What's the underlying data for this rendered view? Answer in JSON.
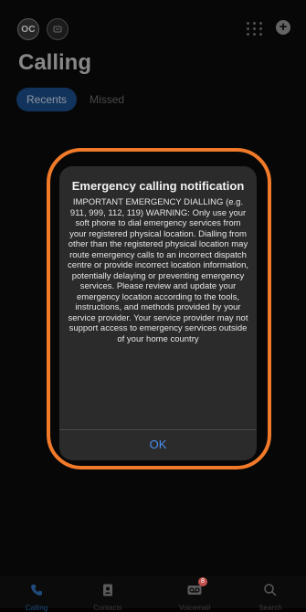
{
  "header": {
    "avatar_initials": "OC",
    "page_title": "Calling"
  },
  "tabs": [
    {
      "label": "Recents",
      "selected": true
    },
    {
      "label": "Missed",
      "selected": false
    }
  ],
  "dialog": {
    "title": "Emergency calling notification",
    "body": "IMPORTANT EMERGENCY DIALLING (e.g. 911, 999, 112, 119) WARNING: Only use your soft phone to dial emergency services from your registered physical location. Dialling from other than the registered physical location may route emergency calls to an incorrect dispatch centre or provide incorrect location information, potentially delaying or preventing emergency services. Please review and update your emergency location according to the tools, instructions, and methods provided by your service provider. Your service provider may not support access to emergency services outside of your home country",
    "ok_label": "OK"
  },
  "bottom_nav": [
    {
      "label": "Calling",
      "icon": "phone-icon",
      "active": true
    },
    {
      "label": "Contacts",
      "icon": "contacts-icon",
      "active": false
    },
    {
      "label": "Voicemail",
      "icon": "voicemail-icon",
      "active": false,
      "badge": "8"
    },
    {
      "label": "Search",
      "icon": "search-icon",
      "active": false
    }
  ],
  "colors": {
    "background": "#0b0b0b",
    "accent": "#1d4f8e",
    "dialog_background": "#2b2b2b",
    "link_blue": "#4a8ef0",
    "highlight_ring": "#f07a29",
    "badge": "#c0504d"
  }
}
